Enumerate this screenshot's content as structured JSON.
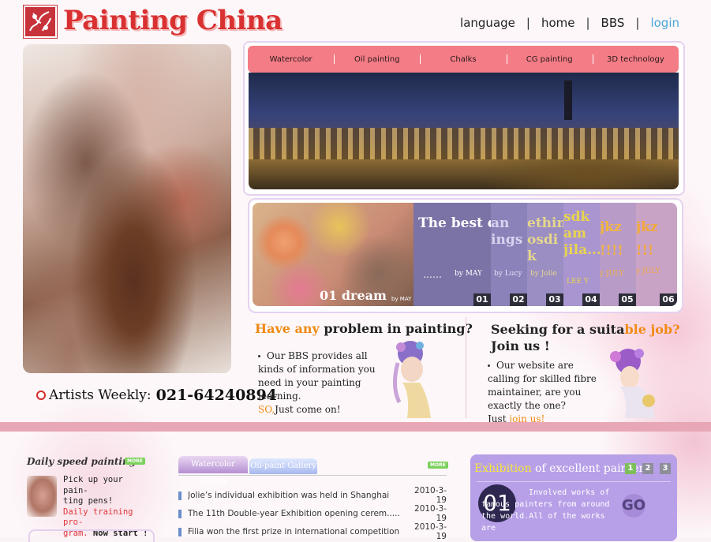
{
  "header": {
    "site_title": "Painting China",
    "nav": [
      "language",
      "home",
      "BBS",
      "login"
    ],
    "nav_sep": "|"
  },
  "category_tabs": [
    "Watercolor",
    "Oil painting",
    "Chalks",
    "CG painting",
    "3D technology"
  ],
  "gallery": {
    "main_caption": "01 dream",
    "main_by": "by MAY",
    "items": [
      {
        "title": "The best dream of us",
        "dots": "……",
        "by": "by MAY",
        "num": "01"
      },
      {
        "title": "an ings",
        "by": "by Lucy",
        "num": "02"
      },
      {
        "title": "ething osdi k",
        "by": "by Jolie",
        "num": "03"
      },
      {
        "title": "sdk am jila...",
        "by": "LEE Y",
        "num": "04"
      },
      {
        "title": "jkz !!!!",
        "by": "y JULY",
        "num": "05"
      },
      {
        "title": "jkz !!!",
        "by": "y JULY",
        "num": "06"
      }
    ]
  },
  "artist_weekly": {
    "label": "Artists Weekly:",
    "phone": "021-64240894"
  },
  "promo_left": {
    "heading_hl": "Have any",
    "heading_rest": " problem in painting?",
    "body": "Our BBS provides all kinds of information you need in your painting learning.",
    "cta_hl": "SO,",
    "cta_rest": "Just come on!"
  },
  "promo_right": {
    "heading_a": "Seeking for a suita",
    "heading_hl": "ble job?",
    "heading_b": "Join us !",
    "body": "Our website are calling for skilled fibre maintainer, are you exactly the one?",
    "cta_a": "Just ",
    "cta_hl": "join us!"
  },
  "daily": {
    "title": "Daily speed painting",
    "more": "MORE",
    "line1": "Pick up your pain-",
    "line2": "ting pens!",
    "line3": "Daily training pro-",
    "line4a": "gram.",
    "line4b": " Now start !"
  },
  "news": {
    "tab1": "Watercolor Gallery",
    "tab2": "Oil-paint Gallery",
    "more": "MORE",
    "items": [
      {
        "title": "Jolie’s individual exhibition was held in Shanghai",
        "date": "2010-3-19"
      },
      {
        "title": "The 11th Double-year Exhibition opening cerem.....",
        "date": "2010-3-19"
      },
      {
        "title": "Filia won the first prize in international competition",
        "date": "2010-3-19"
      }
    ]
  },
  "exhibition": {
    "title_hl": "Exhibition",
    "title_rest": " of excellent painters",
    "pages": [
      "1",
      "2",
      "3"
    ],
    "num": "01",
    "text": "Involved works of famous painters from around the world.All of the works are",
    "go": "GO"
  },
  "colors": {
    "brand_red": "#d93131",
    "tab_pink": "#f37c86",
    "accent_orange": "#f08a14",
    "login_blue": "#4aa5d8",
    "exhibition_purple": "#b8a0e8"
  }
}
